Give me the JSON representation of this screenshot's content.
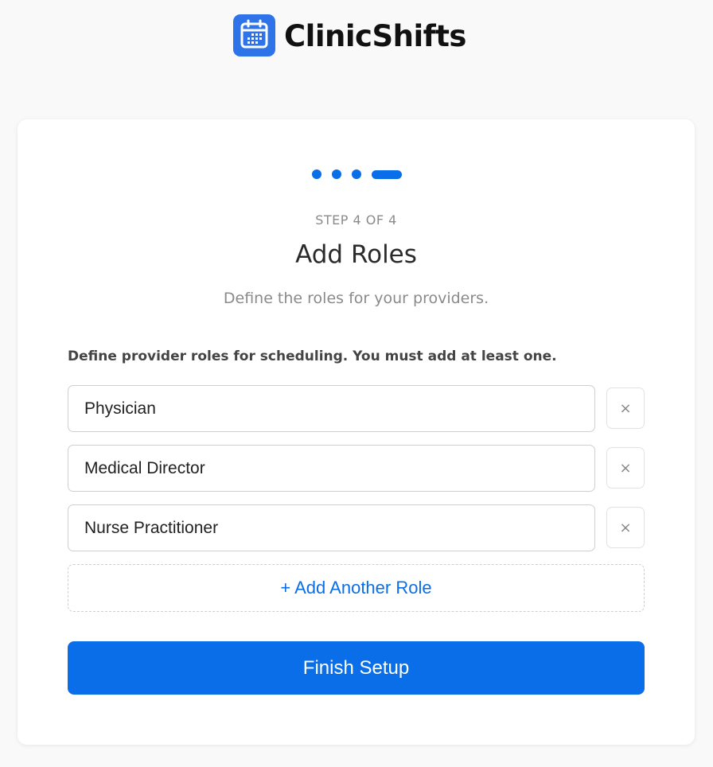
{
  "app": {
    "brand_name": "ClinicShifts",
    "logo_icon": "calendar-icon",
    "accent_color": "#0a6ee8"
  },
  "wizard": {
    "total_steps": 4,
    "current_step": 4,
    "step_label": "STEP 4 OF 4",
    "title": "Add Roles",
    "subtitle": "Define the roles for your providers."
  },
  "roles_form": {
    "instruction": "Define provider roles for scheduling. You must add at least one.",
    "roles": [
      {
        "value": "Physician",
        "remove_icon": "close-icon",
        "remove_label": "×"
      },
      {
        "value": "Medical Director",
        "remove_icon": "close-icon",
        "remove_label": "×"
      },
      {
        "value": "Nurse Practitioner",
        "remove_icon": "close-icon",
        "remove_label": "×"
      }
    ],
    "add_role_label": "+ Add Another Role",
    "finish_label": "Finish Setup"
  }
}
